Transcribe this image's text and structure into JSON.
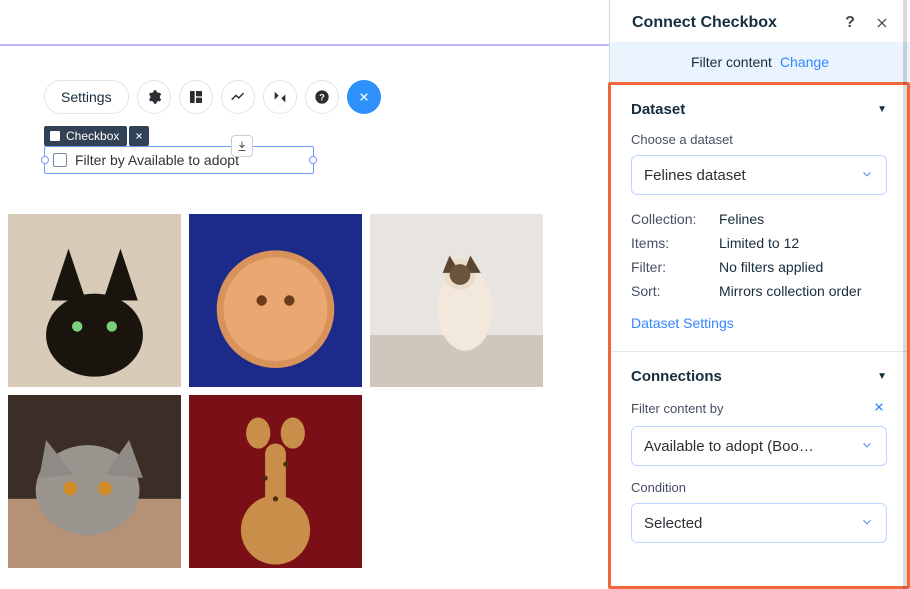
{
  "toolbar": {
    "settings_label": "Settings"
  },
  "selection": {
    "tag_label": "Checkbox",
    "checkbox_label": "Filter by Available to adopt"
  },
  "panel": {
    "title": "Connect Checkbox",
    "subbar": {
      "text": "Filter content",
      "action": "Change"
    },
    "dataset_section": {
      "title": "Dataset",
      "choose_label": "Choose a dataset",
      "selected": "Felines dataset",
      "meta": {
        "collection_label": "Collection:",
        "collection_value": "Felines",
        "items_label": "Items:",
        "items_value": "Limited to 12",
        "filter_label": "Filter:",
        "filter_value": "No filters applied",
        "sort_label": "Sort:",
        "sort_value": "Mirrors collection order"
      },
      "settings_link": "Dataset Settings"
    },
    "connections_section": {
      "title": "Connections",
      "filter_by_label": "Filter content by",
      "filter_by_value": "Available to adopt (Boo…",
      "condition_label": "Condition",
      "condition_value": "Selected"
    }
  }
}
